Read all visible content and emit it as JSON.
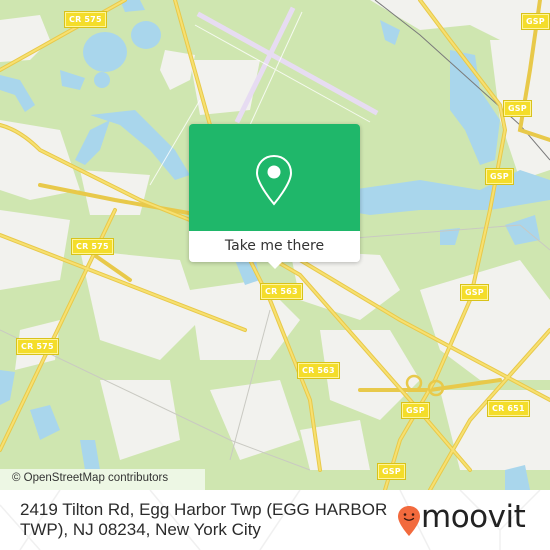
{
  "map": {
    "attribution": "© OpenStreetMap contributors",
    "colors": {
      "land": "#cfe6b0",
      "urban": "#f2f2ee",
      "water": "#a9d6ec",
      "road_major": "#f6dd5c",
      "runway": "#e7dcf2",
      "label_bg": "#f4dd2a"
    },
    "road_labels": [
      {
        "text": "CR 575"
      },
      {
        "text": "GSP"
      },
      {
        "text": "GSP"
      },
      {
        "text": "GSP"
      },
      {
        "text": "CR 575"
      },
      {
        "text": "CR 563"
      },
      {
        "text": "GSP"
      },
      {
        "text": "CR 575"
      },
      {
        "text": "CR 563"
      },
      {
        "text": "GSP"
      },
      {
        "text": "CR 651"
      },
      {
        "text": "GSP"
      }
    ]
  },
  "popup": {
    "icon": "map-pin-icon",
    "button_label": "Take me there",
    "color": "#1fb76a"
  },
  "footer": {
    "address": "2419 Tilton Rd, Egg Harbor Twp (EGG HARBOR TWP), NJ 08234, New York City",
    "brand": "moovit",
    "brand_color": "#f26a3d"
  }
}
